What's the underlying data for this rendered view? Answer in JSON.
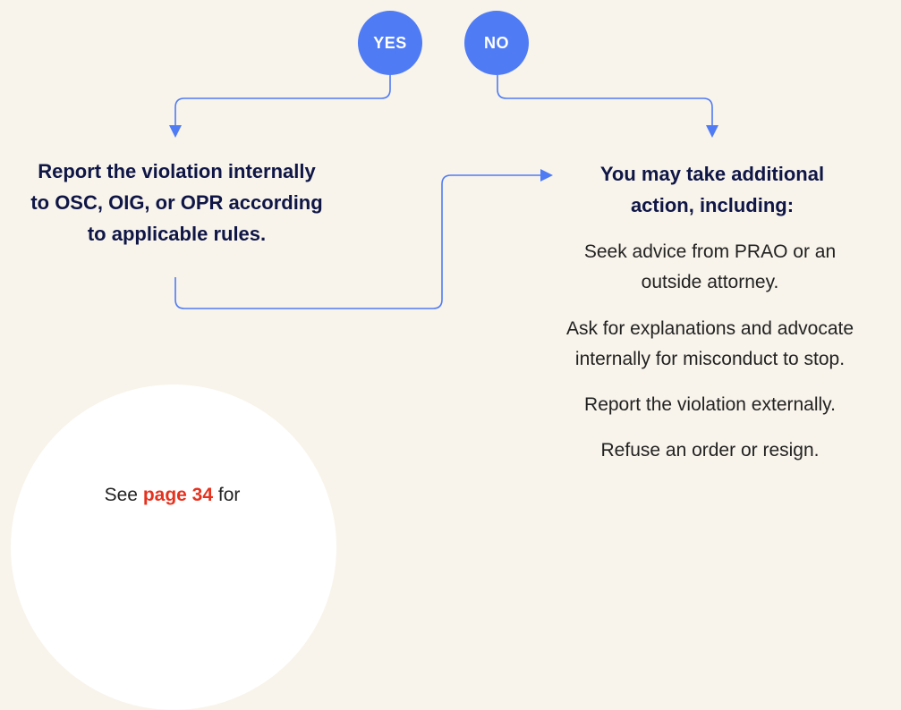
{
  "badges": {
    "yes": "YES",
    "no": "NO"
  },
  "left_box": {
    "lines": [
      "Report the violation internally",
      "to OSC, OIG, or OPR according",
      "to applicable rules."
    ]
  },
  "right_box": {
    "heading_lines": [
      "You may take additional",
      "action, including:"
    ],
    "actions": [
      [
        "Seek advice from PRAO or an",
        "outside attorney."
      ],
      [
        "Ask for explanations and advocate",
        "internally for misconduct to stop."
      ],
      [
        "Report the violation externally."
      ],
      [
        "Refuse an order or resign."
      ]
    ]
  },
  "see_note": {
    "prefix": "See ",
    "link": "page 34",
    "suffix": " for"
  },
  "colors": {
    "background": "#f8f4eb",
    "badge": "#4f7bf4",
    "arrow": "#4f7bf4",
    "heading": "#0f1646",
    "link": "#e5321f"
  }
}
